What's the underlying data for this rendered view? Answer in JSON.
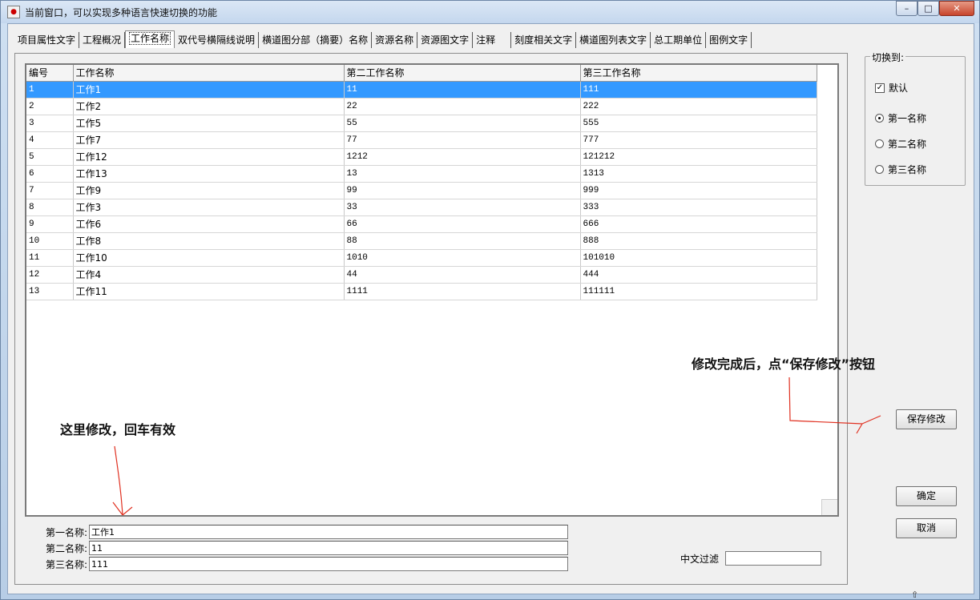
{
  "window": {
    "title": "当前窗口，可以实现多种语言快速切换的功能",
    "minimize_label": "–",
    "maximize_label": "□",
    "close_label": "✕"
  },
  "tabs": [
    {
      "label": "项目属性文字"
    },
    {
      "label": "工程概况"
    },
    {
      "label": "工作名称"
    },
    {
      "label": "双代号横隔线说明"
    },
    {
      "label": "横道图分部（摘要）名称"
    },
    {
      "label": "资源名称"
    },
    {
      "label": "资源图文字"
    },
    {
      "label": "注释"
    },
    {
      "label": "刻度相关文字"
    },
    {
      "label": "横道图列表文字"
    },
    {
      "label": "总工期单位"
    },
    {
      "label": "图例文字"
    }
  ],
  "grid": {
    "headers": [
      "编号",
      "工作名称",
      "第二工作名称",
      "第三工作名称"
    ],
    "rows": [
      [
        "1",
        "工作1",
        "11",
        "111"
      ],
      [
        "2",
        "工作2",
        "22",
        "222"
      ],
      [
        "3",
        "工作5",
        "55",
        "555"
      ],
      [
        "4",
        "工作7",
        "77",
        "777"
      ],
      [
        "5",
        "工作12",
        "1212",
        "121212"
      ],
      [
        "6",
        "工作13",
        "13",
        "1313"
      ],
      [
        "7",
        "工作9",
        "99",
        "999"
      ],
      [
        "8",
        "工作3",
        "33",
        "333"
      ],
      [
        "9",
        "工作6",
        "66",
        "666"
      ],
      [
        "10",
        "工作8",
        "88",
        "888"
      ],
      [
        "11",
        "工作10",
        "1010",
        "101010"
      ],
      [
        "12",
        "工作4",
        "44",
        "444"
      ],
      [
        "13",
        "工作11",
        "1111",
        "111111"
      ]
    ],
    "selected_row": 0,
    "selected_color": "#3399ff"
  },
  "form": {
    "first_label": "第一名称:",
    "first_value": "工作1",
    "second_label": "第二名称:",
    "second_value": "11",
    "third_label": "第三名称:",
    "third_value": "111"
  },
  "filter": {
    "label": "中文过滤",
    "value": ""
  },
  "switch_group": {
    "title": "切换到:",
    "default_label": "默认",
    "default_checked": true,
    "option1": "第一名称",
    "option2": "第二名称",
    "option3": "第三名称",
    "selected": "第一名称"
  },
  "buttons": {
    "save": "保存修改",
    "ok": "确定",
    "cancel": "取消"
  },
  "annotations": {
    "edit_hint": "这里修改，回车有效",
    "save_hint": "修改完成后，点“保存修改”按钮"
  },
  "colors": {
    "annotation_arrow": "#e03020"
  }
}
